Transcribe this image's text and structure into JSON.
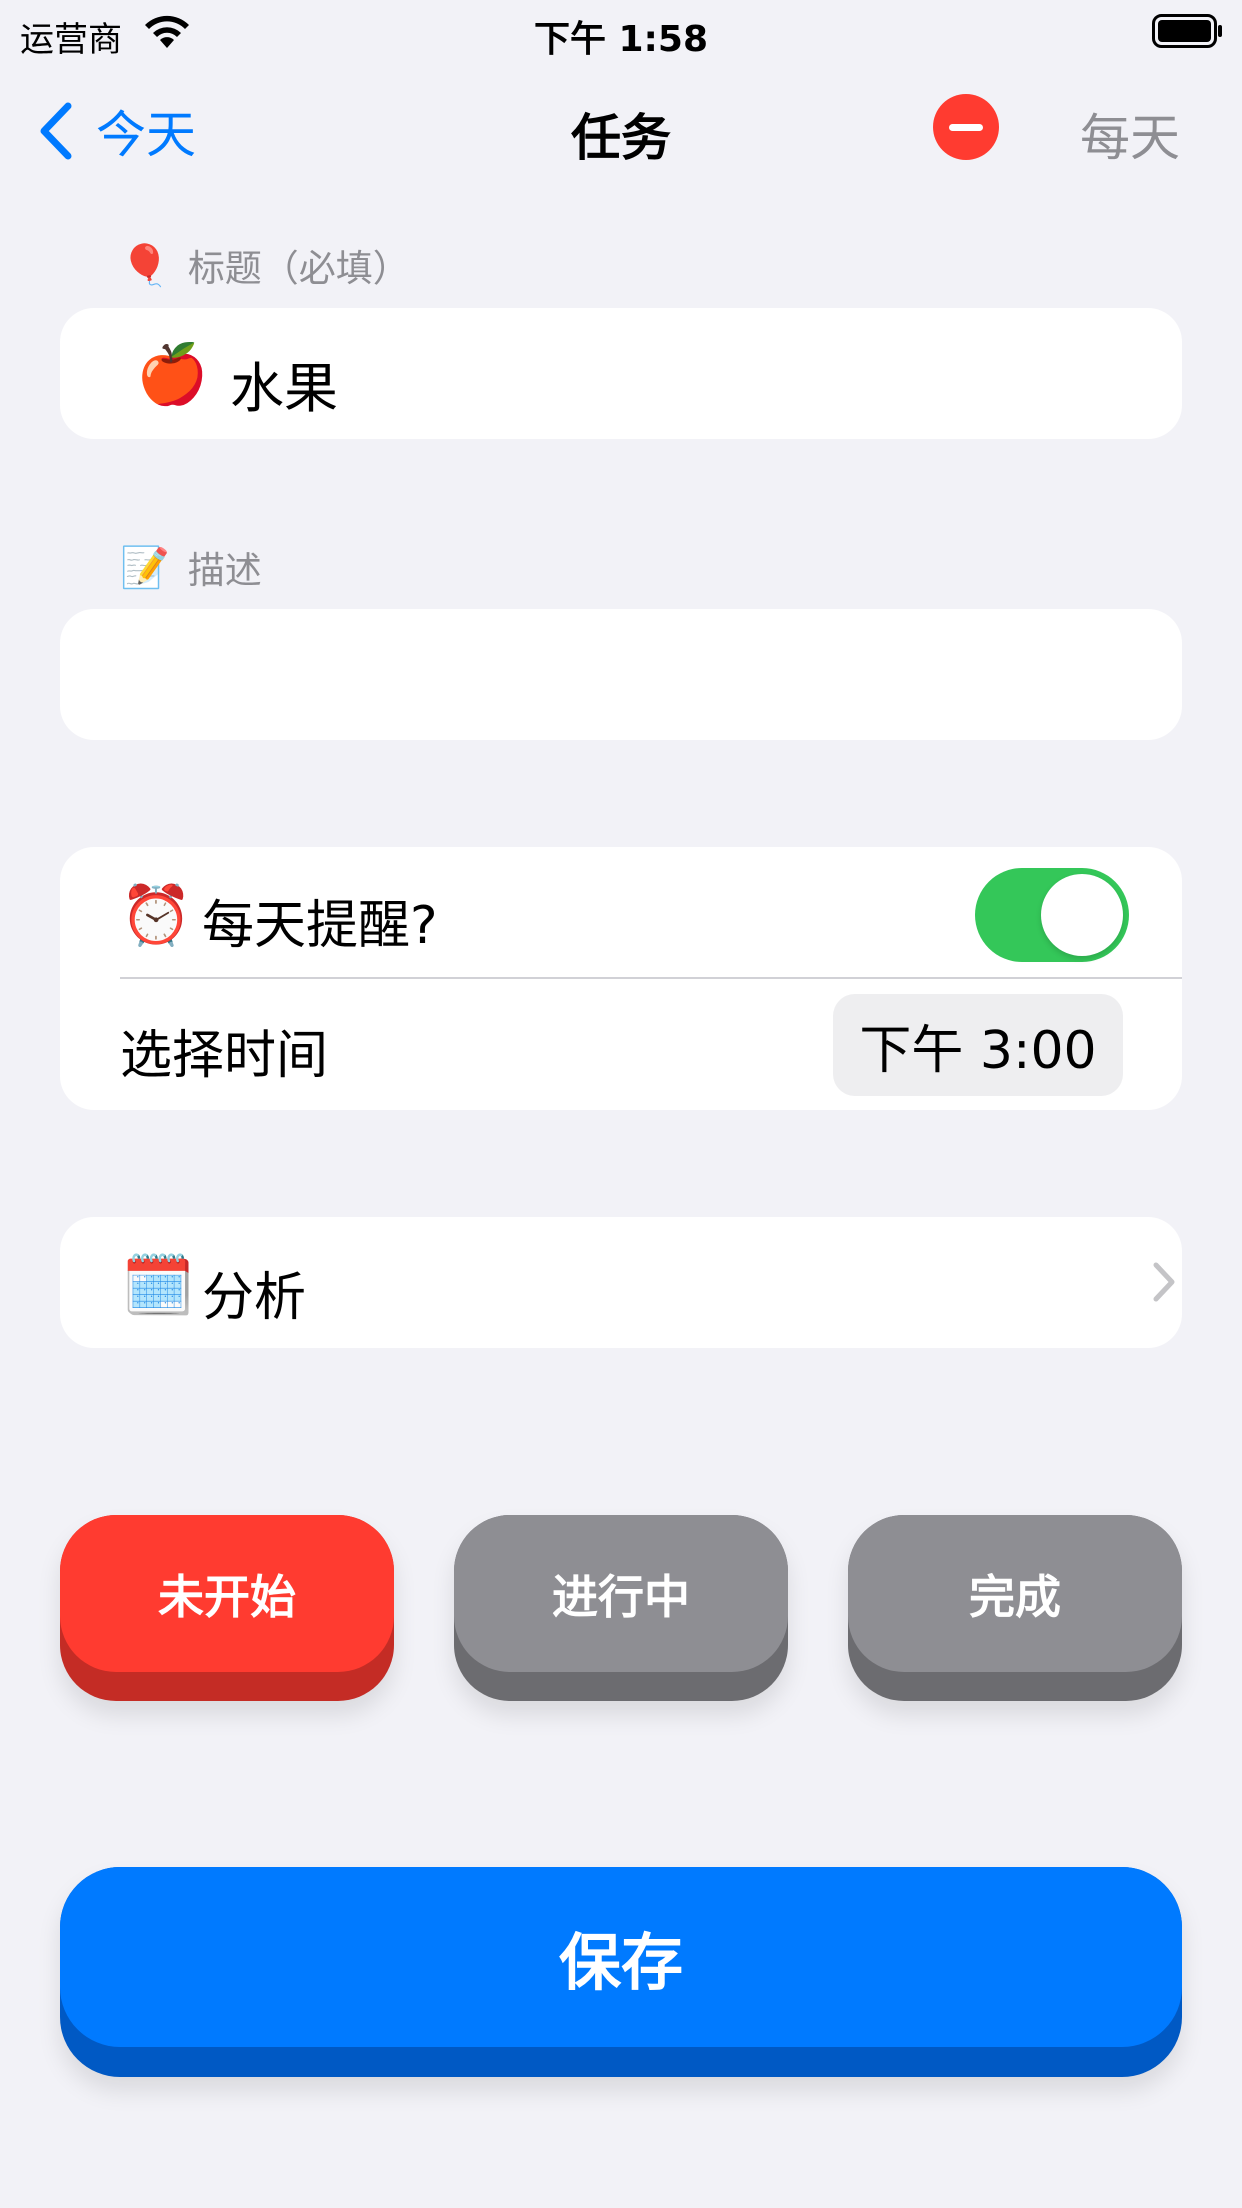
{
  "status_bar": {
    "carrier": "运营商",
    "time": "下午 1:58"
  },
  "nav": {
    "back_label": "今天",
    "title": "任务",
    "right_label": "每天"
  },
  "title_section": {
    "label_emoji": "🎈",
    "label": "标题（必填）",
    "value_emoji": "🍎",
    "value": "水果"
  },
  "description_section": {
    "label_emoji": "📝",
    "label": "描述",
    "value": ""
  },
  "reminder": {
    "emoji": "⏰",
    "label": "每天提醒?",
    "enabled": true,
    "time_label": "选择时间",
    "time_value": "下午 3:00"
  },
  "analysis": {
    "emoji": "🗓️",
    "label": "分析"
  },
  "status_buttons": {
    "not_started": "未开始",
    "in_progress": "进行中",
    "done": "完成"
  },
  "save_label": "保存",
  "colors": {
    "accent": "#007aff",
    "danger": "#ff3b30",
    "toggle_on": "#34c759",
    "inactive": "#8e8e93"
  }
}
